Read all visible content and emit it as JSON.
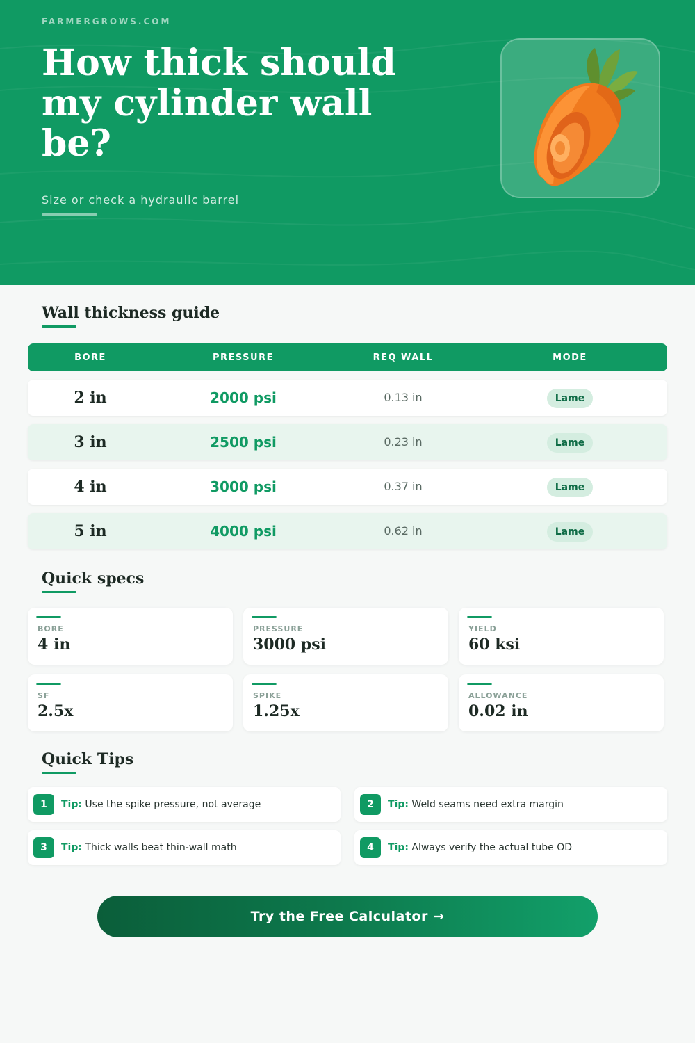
{
  "hero": {
    "site": "FARMERGROWS.COM",
    "title": "How thick should my cylinder wall be?",
    "subtitle": "Size or check a hydraulic barrel",
    "icon": "carrot-icon"
  },
  "table_section": {
    "title": "Wall thickness guide",
    "headers": [
      "BORE",
      "PRESSURE",
      "REQ WALL",
      "MODE"
    ],
    "rows": [
      {
        "bore": "2 in",
        "pressure": "2000 psi",
        "wall": "0.13 in",
        "mode": "Lame"
      },
      {
        "bore": "3 in",
        "pressure": "2500 psi",
        "wall": "0.23 in",
        "mode": "Lame"
      },
      {
        "bore": "4 in",
        "pressure": "3000 psi",
        "wall": "0.37 in",
        "mode": "Lame"
      },
      {
        "bore": "5 in",
        "pressure": "4000 psi",
        "wall": "0.62 in",
        "mode": "Lame"
      }
    ]
  },
  "specs_section": {
    "title": "Quick specs",
    "items": [
      {
        "label": "BORE",
        "value": "4 in"
      },
      {
        "label": "PRESSURE",
        "value": "3000 psi"
      },
      {
        "label": "YIELD",
        "value": "60 ksi"
      },
      {
        "label": "SF",
        "value": "2.5x"
      },
      {
        "label": "SPIKE",
        "value": "1.25x"
      },
      {
        "label": "ALLOWANCE",
        "value": "0.02 in"
      }
    ]
  },
  "tips_section": {
    "title": "Quick Tips",
    "tip_label": "Tip:",
    "items": [
      {
        "num": "1",
        "text": "Use the spike pressure, not average"
      },
      {
        "num": "2",
        "text": "Weld seams need extra margin"
      },
      {
        "num": "3",
        "text": "Thick walls beat thin-wall math"
      },
      {
        "num": "4",
        "text": "Always verify the actual tube OD"
      }
    ]
  },
  "cta": {
    "label": "Try the Free Calculator →"
  },
  "colors": {
    "brand": "#109a63",
    "brand_dark": "#0b5e3a",
    "row_tint": "#e8f5ee",
    "badge_bg": "#d4ede0"
  }
}
